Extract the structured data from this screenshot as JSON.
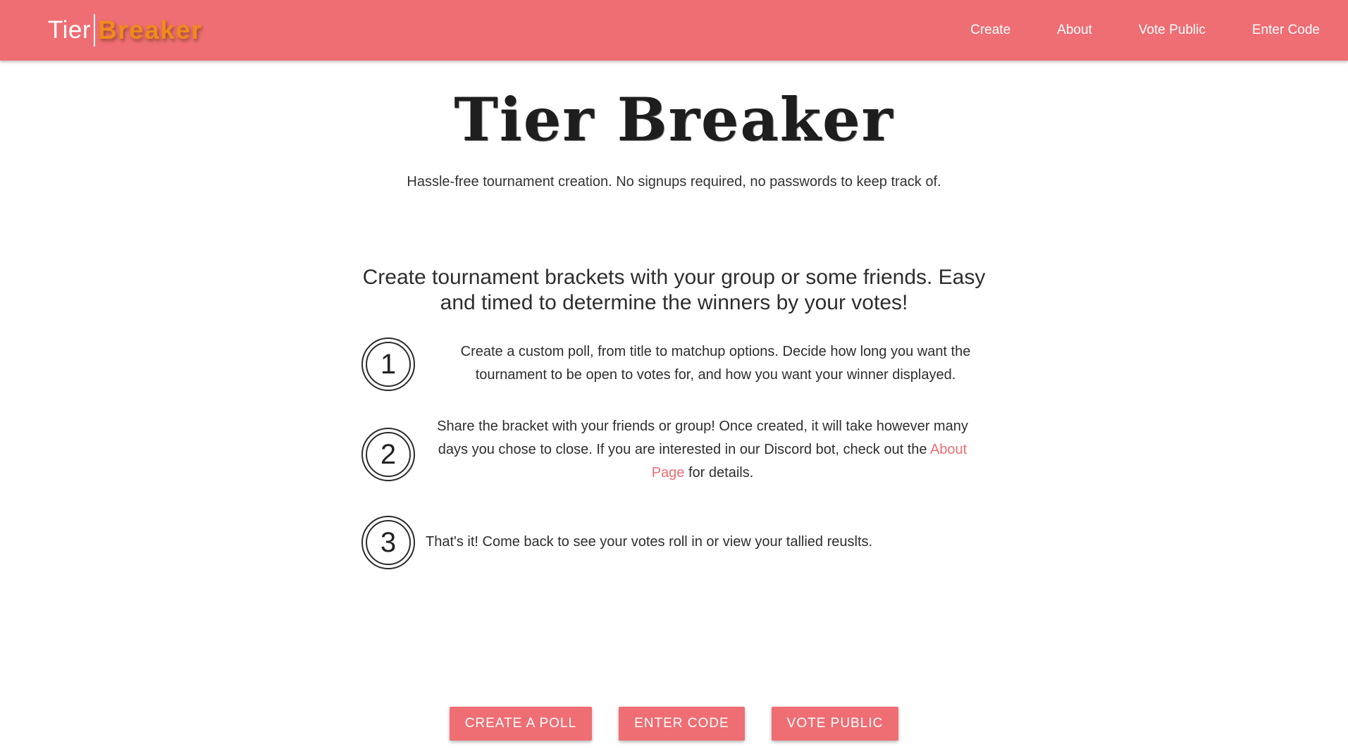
{
  "navbar": {
    "brand_tier": "Tier",
    "brand_breaker": "Breaker",
    "links": [
      "Create",
      "About",
      "Vote Public",
      "Enter Code"
    ],
    "background": "#ee6e73",
    "brand_accent": "#f08a1c"
  },
  "hero": {
    "title": "Tier Breaker",
    "tagline": "Hassle-free tournament creation. No signups required, no passwords to keep track of."
  },
  "intro": "Create tournament brackets with your group or some friends. Easy and timed to determine the winners by your votes!",
  "steps": [
    {
      "number": "1",
      "text": "Create a custom poll, from title to matchup options. Decide how long you want the tournament to be open to votes for, and how you want your winner displayed."
    },
    {
      "number": "2",
      "text_before": "Share the bracket with your friends or group! Once created, it will take however many days you chose to close. If you are interested in our Discord bot, check out the",
      "link": "About Page",
      "text_after": "for details."
    },
    {
      "number": "3",
      "text": "That's it! Come back to see your votes roll in or view your tallied reuslts."
    }
  ],
  "actions": {
    "create_poll": "CREATE A POLL",
    "enter_code": "ENTER CODE",
    "vote_public": "VOTE PUBLIC"
  }
}
